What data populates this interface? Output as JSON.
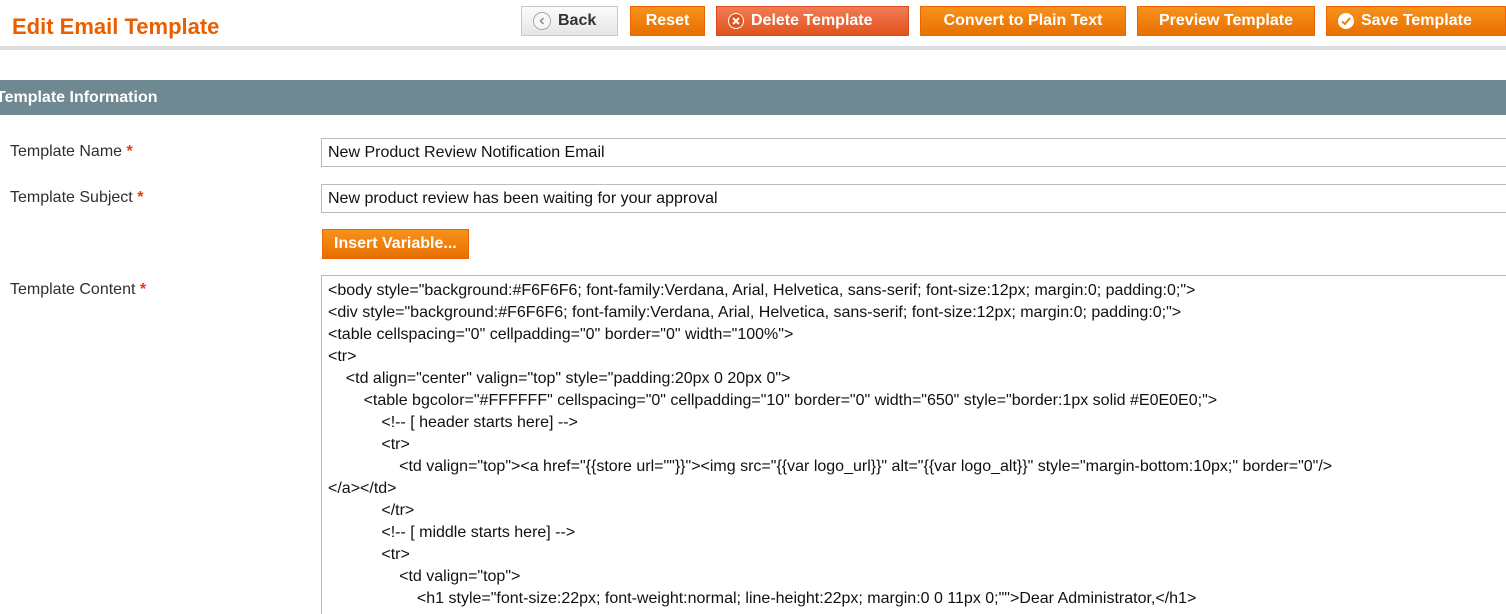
{
  "header": {
    "title": "Edit Email Template",
    "buttons": {
      "back": "Back",
      "reset": "Reset",
      "delete": "Delete Template",
      "convert": "Convert to Plain Text",
      "preview": "Preview Template",
      "save": "Save Template"
    }
  },
  "section": {
    "title": "Template Information"
  },
  "form": {
    "name": {
      "label": "Template Name",
      "required_mark": "*",
      "value": "New Product Review Notification Email"
    },
    "subject": {
      "label": "Template Subject",
      "required_mark": "*",
      "value": "New product review has been waiting for your approval"
    },
    "insert_variable": "Insert Variable...",
    "content": {
      "label": "Template Content",
      "required_mark": "*",
      "lines": [
        "<body style=\"background:#F6F6F6; font-family:Verdana, Arial, Helvetica, sans-serif; font-size:12px; margin:0; padding:0;\">",
        "<div style=\"background:#F6F6F6; font-family:Verdana, Arial, Helvetica, sans-serif; font-size:12px; margin:0; padding:0;\">",
        "<table cellspacing=\"0\" cellpadding=\"0\" border=\"0\" width=\"100%\">",
        "<tr>",
        "    <td align=\"center\" valign=\"top\" style=\"padding:20px 0 20px 0\">",
        "        <table bgcolor=\"#FFFFFF\" cellspacing=\"0\" cellpadding=\"10\" border=\"0\" width=\"650\" style=\"border:1px solid #E0E0E0;\">",
        "            <!-- [ header starts here] -->",
        "            <tr>",
        "                <td valign=\"top\"><a href=\"{{store url=\"\"}}\"><img src=\"{{var logo_url}}\" alt=\"{{var logo_alt}}\" style=\"margin-bottom:10px;\" border=\"0\"/>",
        "</a></td>",
        "            </tr>",
        "            <!-- [ middle starts here] -->",
        "            <tr>",
        "                <td valign=\"top\">",
        "                    <h1 style=\"font-size:22px; font-weight:normal; line-height:22px; margin:0 0 11px 0;\"\">Dear Administrator,</h1>"
      ]
    }
  },
  "colors": {
    "accent": "#eb5e00",
    "button": "#f18200",
    "section_bar": "#6f8992",
    "required": "#eb340a"
  },
  "icons": {
    "back": "chevron-left-icon",
    "delete": "close-circle-icon",
    "save": "check-circle-icon"
  }
}
